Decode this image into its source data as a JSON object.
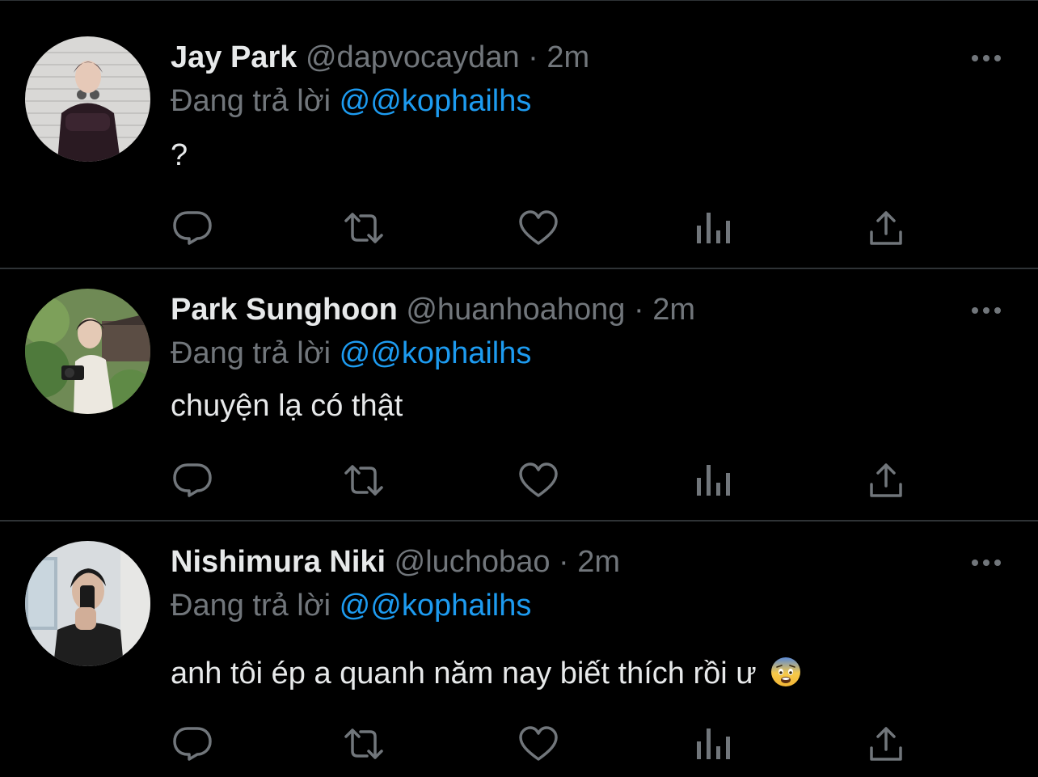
{
  "reply_prefix": "Đang trả lời",
  "separator": "·",
  "tweets": [
    {
      "name": "Jay Park",
      "handle": "@dapvocaydan",
      "time": "2m",
      "reply_to": "@@kophailhs",
      "text": "?",
      "emoji": ""
    },
    {
      "name": "Park Sunghoon",
      "handle": "@huanhoahong",
      "time": "2m",
      "reply_to": "@@kophailhs",
      "text": "chuyện lạ có thật",
      "emoji": ""
    },
    {
      "name": "Nishimura Niki",
      "handle": "@luchobao",
      "time": "2m",
      "reply_to": "@@kophailhs",
      "text": "anh tôi ép a quanh năm nay biết thích rồi ư",
      "emoji": "fearful-face-icon"
    }
  ],
  "colors": {
    "background": "#000000",
    "name": "#e7e9ea",
    "secondary": "#71767b",
    "mention": "#1d9bf0",
    "divider": "#2f3336"
  },
  "icons": [
    "reply-icon",
    "retweet-icon",
    "like-icon",
    "stats-icon",
    "share-icon",
    "more-icon"
  ]
}
